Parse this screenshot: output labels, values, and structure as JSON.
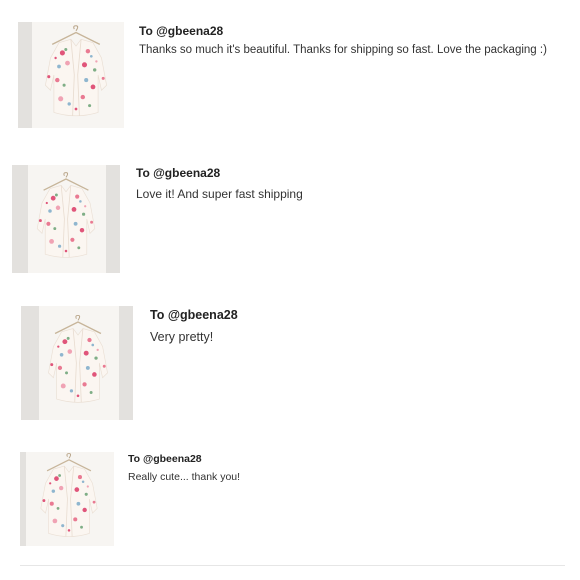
{
  "reviews": [
    {
      "to": "To @gbeena28",
      "message": "Thanks so much it's beautiful. Thanks for shipping so fast. Love the packaging :)"
    },
    {
      "to": "To @gbeena28",
      "message": "Love it! And super fast shipping"
    },
    {
      "to": "To @gbeena28",
      "message": "Very pretty!"
    },
    {
      "to": "To @gbeena28",
      "message": "Really cute... thank you!"
    }
  ],
  "colors": {
    "background": "#ffffff",
    "text": "#333333",
    "photo_background": "#f7f5f2",
    "photo_side_strip": "#e3e1de",
    "floral_pink": "#e0557a",
    "floral_green": "#7fae86",
    "floral_blue": "#8fb6cf"
  }
}
